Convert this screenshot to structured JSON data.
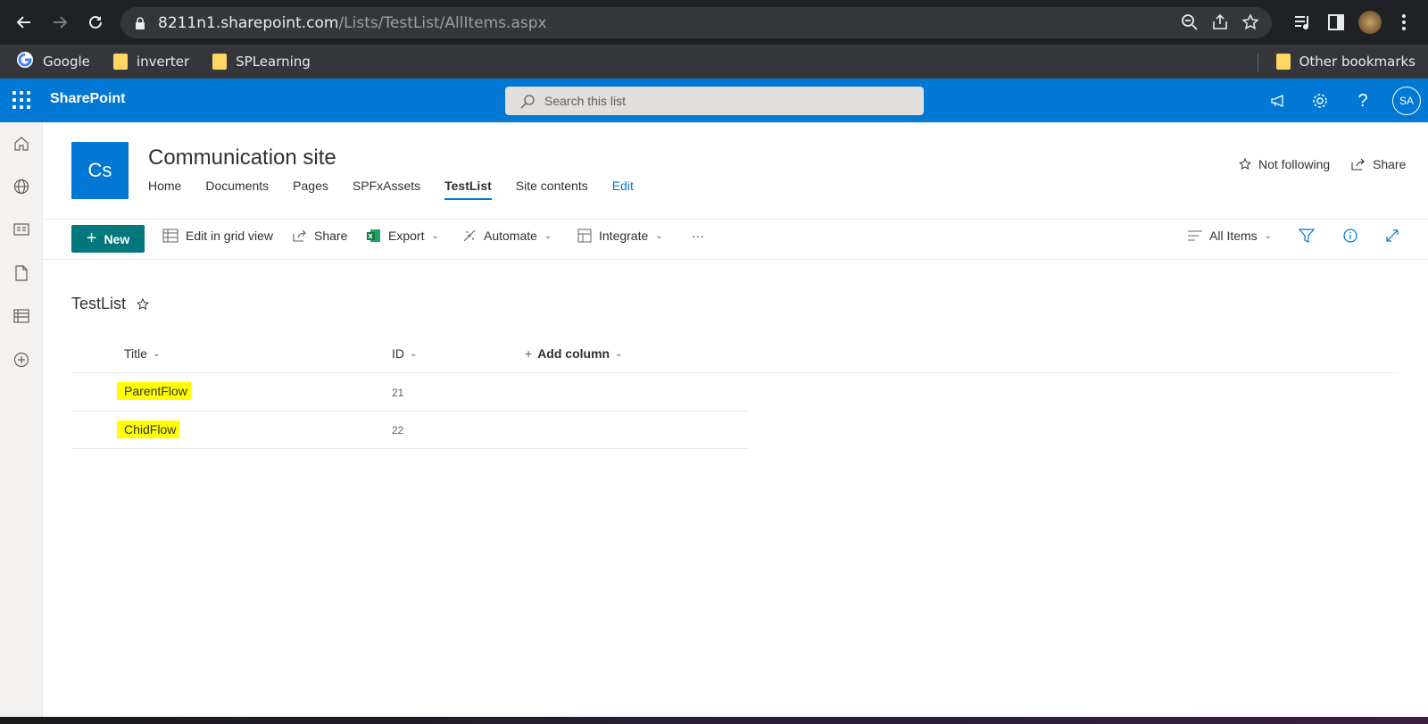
{
  "browser": {
    "url_host": "8211n1.sharepoint.com",
    "url_path": "/Lists/TestList/AllItems.aspx",
    "bookmarks": [
      {
        "label": "Google",
        "icon": "google-icon"
      },
      {
        "label": "inverter",
        "icon": "folder-icon"
      },
      {
        "label": "SPLearning",
        "icon": "folder-icon"
      }
    ],
    "other_bookmarks": "Other bookmarks"
  },
  "suitebar": {
    "app_name": "SharePoint",
    "search_placeholder": "Search this list",
    "avatar_initials": "SA",
    "color": "#0078d4"
  },
  "site": {
    "logo_text": "Cs",
    "title": "Communication site",
    "nav": [
      "Home",
      "Documents",
      "Pages",
      "SPFxAssets",
      "TestList",
      "Site contents",
      "Edit"
    ],
    "active_nav": "TestList",
    "follow_label": "Not following",
    "share_label": "Share"
  },
  "commandbar": {
    "new_label": "New",
    "grid_label": "Edit in grid view",
    "share_label": "Share",
    "export_label": "Export",
    "automate_label": "Automate",
    "integrate_label": "Integrate",
    "more_label": "···",
    "view_label": "All Items",
    "accent": "#03787c"
  },
  "list": {
    "title": "TestList",
    "columns": {
      "title": "Title",
      "id": "ID",
      "add": "Add column"
    },
    "rows": [
      {
        "title": "ParentFlow",
        "id": "21"
      },
      {
        "title": "ChidFlow",
        "id": "22"
      }
    ],
    "highlight": "#ffff00"
  }
}
